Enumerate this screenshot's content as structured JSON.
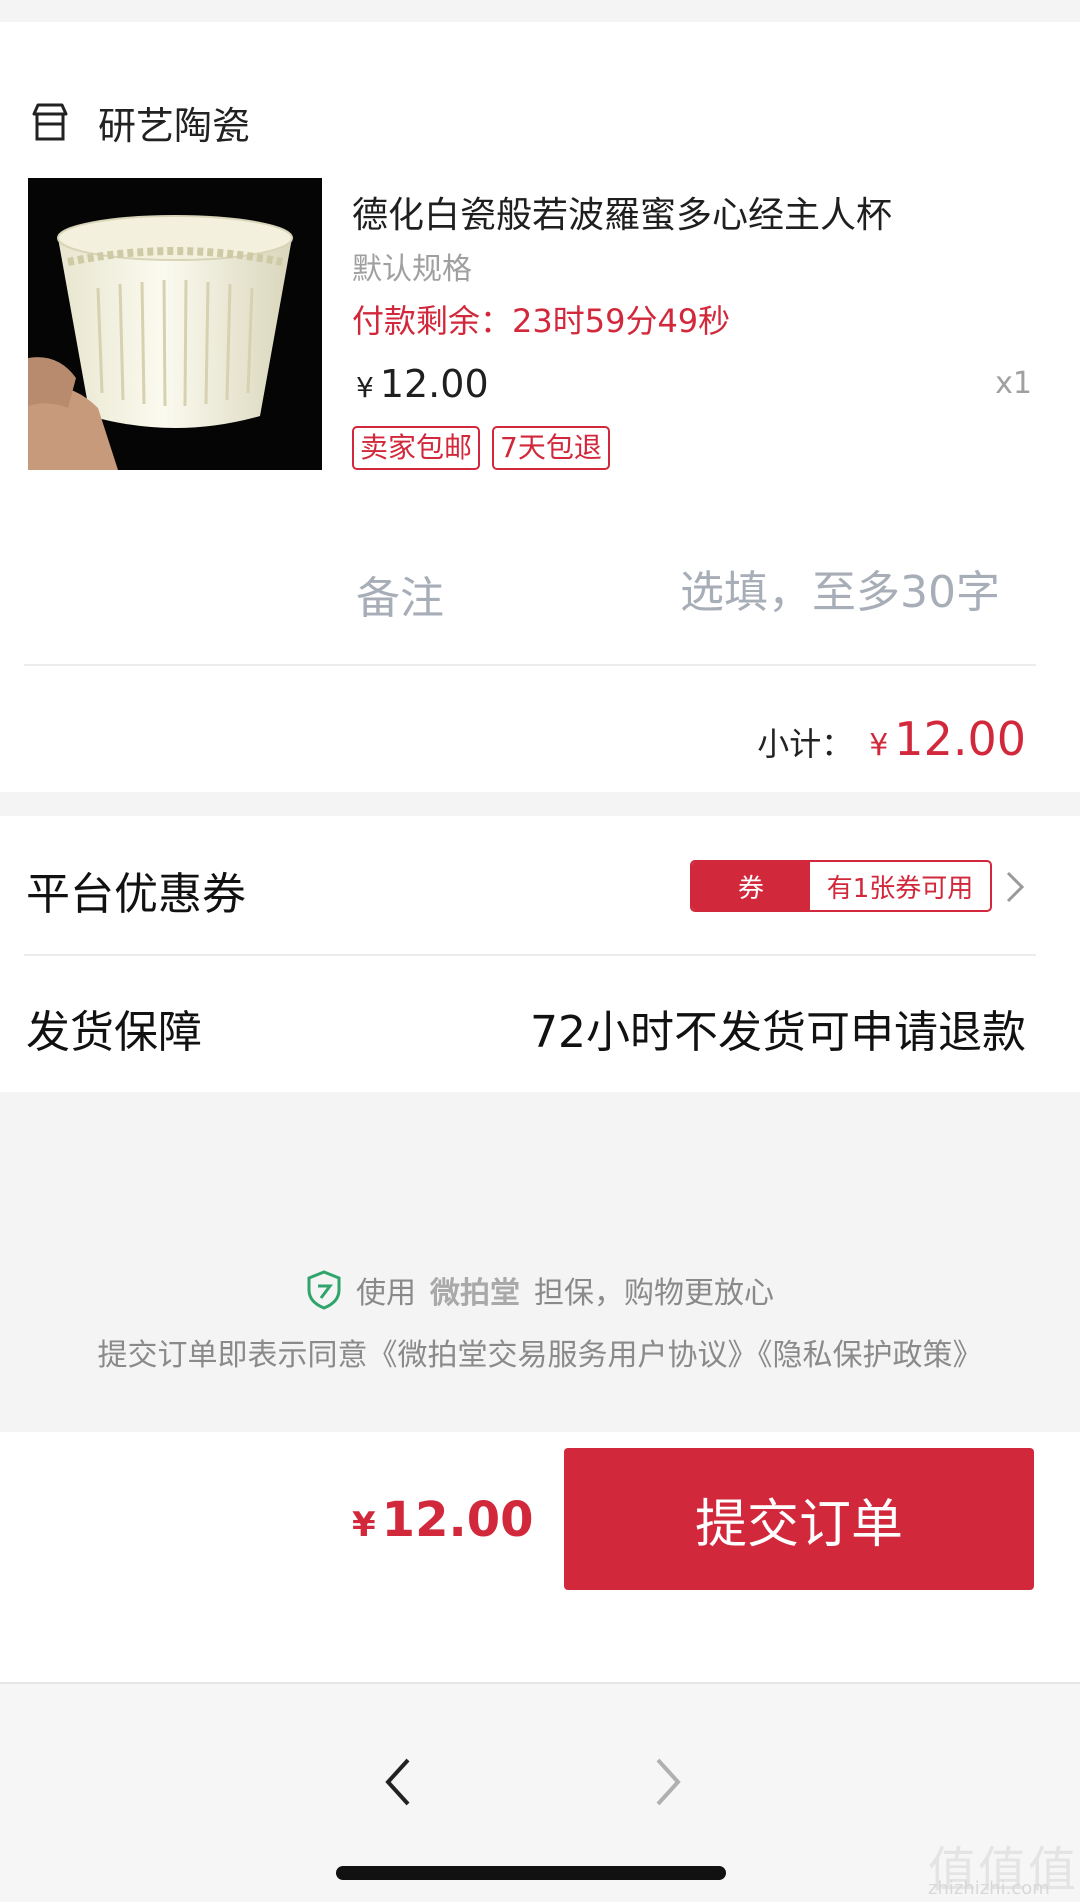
{
  "shop": {
    "name": "研艺陶瓷",
    "icon": "store-icon"
  },
  "product": {
    "title": "德化白瓷般若波羅蜜多心经主人杯",
    "spec": "默认规格",
    "countdown": "付款剩余：23时59分49秒",
    "price_symbol": "¥",
    "price": "12.00",
    "qty": "x1",
    "tags": [
      "卖家包邮",
      "7天包退"
    ],
    "image": "porcelain-cup-image"
  },
  "remark": {
    "label": "备注",
    "placeholder": "选填，至多30字"
  },
  "subtotal": {
    "label": "小计：",
    "symbol": "¥",
    "value": "12.00"
  },
  "coupon": {
    "label": "平台优惠券",
    "badge_left": "券",
    "badge_right": "有1张券可用"
  },
  "shipping": {
    "label": "发货保障",
    "value": "72小时不发货可申请退款"
  },
  "guarantee": {
    "prefix": "使用",
    "brand": "微拍堂",
    "suffix": "担保，购物更放心"
  },
  "agreement": "提交订单即表示同意《微拍堂交易服务用户协议》《隐私保护政策》",
  "footer": {
    "total_symbol": "¥",
    "total_value": "12.00",
    "submit_label": "提交订单"
  },
  "colors": {
    "accent": "#d2283b",
    "muted": "#a0a0a0",
    "background": "#f4f4f4"
  },
  "watermark": {
    "main": "值值值",
    "sub": "zhizhizhi.com"
  }
}
